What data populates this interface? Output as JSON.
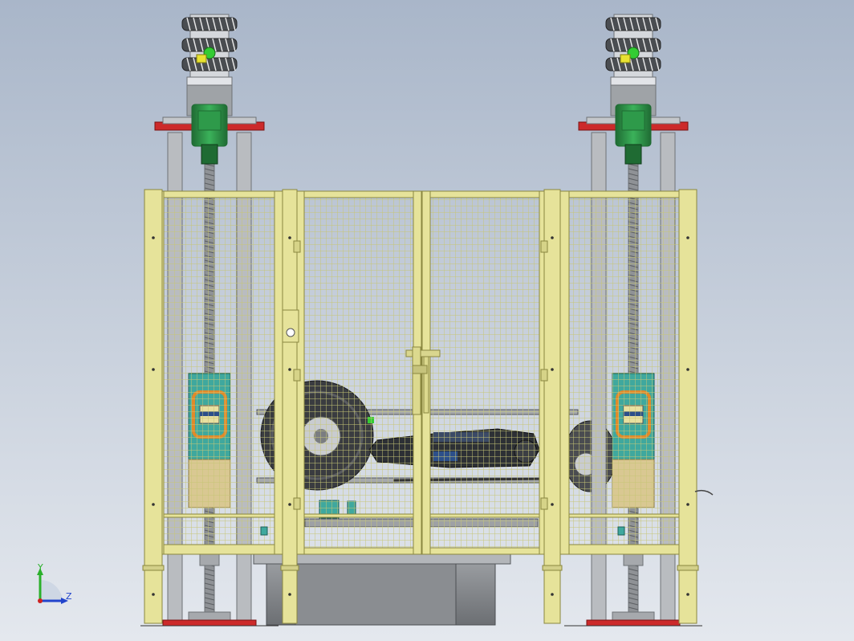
{
  "viewport": {
    "background_top": "#a9b6c9",
    "background_bottom": "#e4e8ee"
  },
  "colors": {
    "frame_yellow": "#e6e39a",
    "frame_edge": "#8a8740",
    "mesh": "#c7c676",
    "base_red": "#cc2a2a",
    "motor_green": "#2e9a4a",
    "motor_dark": "#1f6b33",
    "steel": "#b9bcc0",
    "steel_dark": "#6e7276",
    "tire": "#3a3c40",
    "cabinet": "#7b7e82",
    "teal": "#3fa89e",
    "orange": "#e08a2a",
    "sensor_green": "#33cc33",
    "sensor_yellow": "#e8e232",
    "axis_y": "#2bb02b",
    "axis_x": "#cc2222",
    "axis_z": "#2244cc"
  },
  "triad": {
    "y_label": "Y",
    "z_label": "Z",
    "icon": "coordinate-triad-icon"
  }
}
